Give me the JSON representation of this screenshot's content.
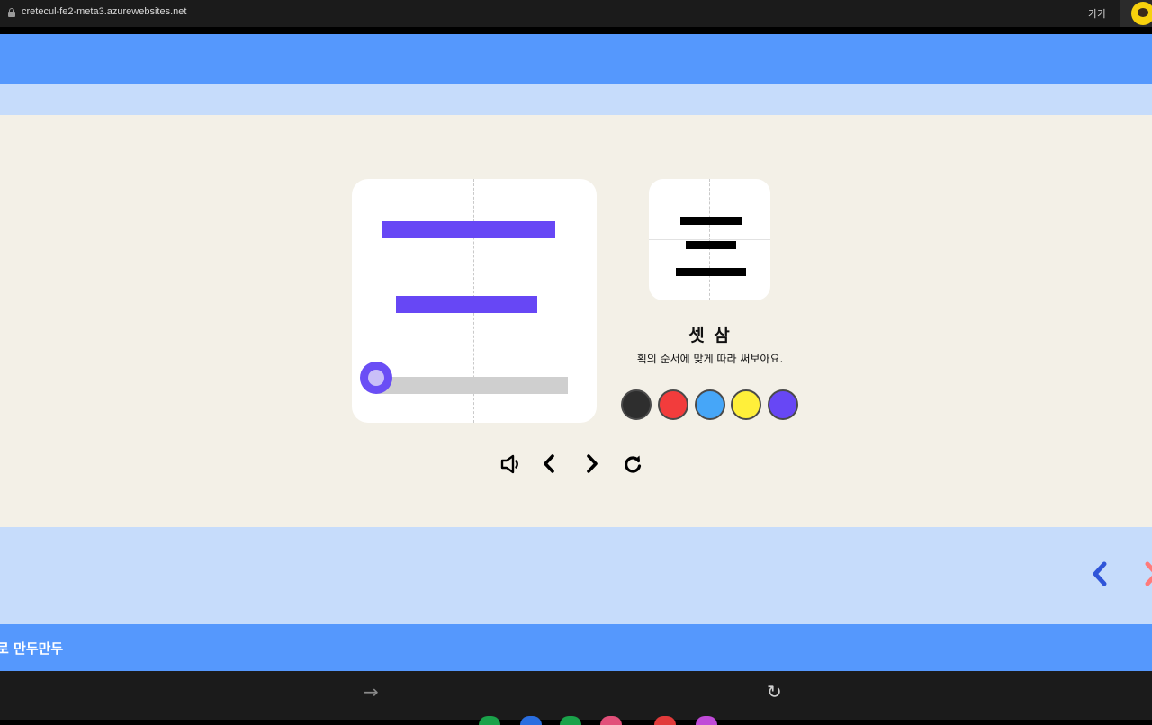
{
  "browser": {
    "url": "cretecul-fe2-meta3.azurewebsites.net",
    "text_size_label": "가가"
  },
  "footer": {
    "text": "로 만두만두"
  },
  "stroke_practice": {
    "character": "三",
    "character_name": "셋 삼",
    "instruction": "획의 순서에 맞게 따라 써보아요.",
    "stroke_color": "#6747f5",
    "strokes_completed": 2,
    "strokes_total": 3
  },
  "palette": {
    "colors": [
      "#2e2e2e",
      "#f23c3c",
      "#46a6f8",
      "#ffef3a",
      "#6747f5"
    ],
    "selected_index": 4
  },
  "controls": [
    "sound-icon",
    "chevron-left-icon",
    "chevron-right-icon",
    "refresh-icon"
  ],
  "page_nav": {
    "prev_color": "#2f55d8",
    "next_color": "#ff7a7a"
  },
  "dock_colors": [
    "#1aa24a",
    "#2a6ee0",
    "#1aa24a",
    "#e2507a",
    "#e23a3a",
    "#c04ad8"
  ]
}
